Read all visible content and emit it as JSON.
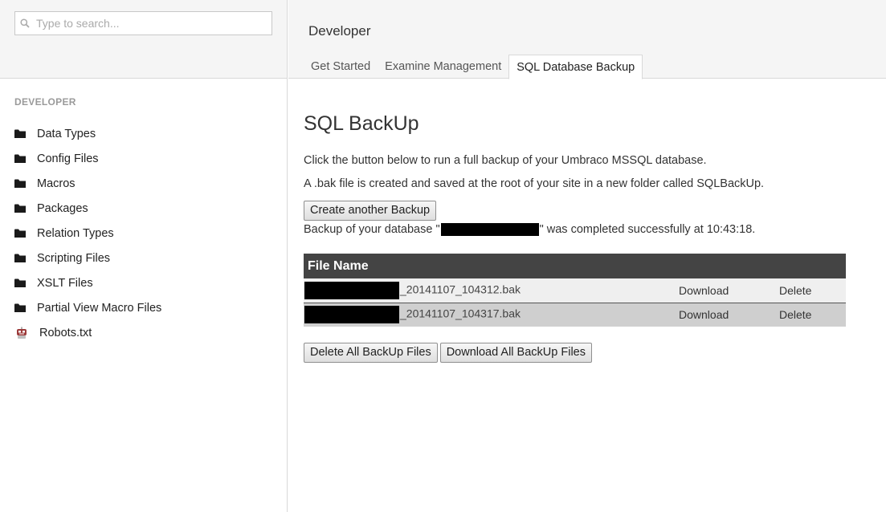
{
  "search": {
    "placeholder": "Type to search..."
  },
  "sidebar": {
    "heading": "DEVELOPER",
    "items": [
      {
        "label": "Data Types",
        "icon": "folder-icon"
      },
      {
        "label": "Config Files",
        "icon": "folder-icon"
      },
      {
        "label": "Macros",
        "icon": "folder-icon"
      },
      {
        "label": "Packages",
        "icon": "folder-icon"
      },
      {
        "label": "Relation Types",
        "icon": "folder-icon"
      },
      {
        "label": "Scripting Files",
        "icon": "folder-icon"
      },
      {
        "label": "XSLT Files",
        "icon": "folder-icon"
      },
      {
        "label": "Partial View Macro Files",
        "icon": "folder-icon"
      },
      {
        "label": "Robots.txt",
        "icon": "robot-icon"
      }
    ]
  },
  "header": {
    "section": "Developer",
    "tabs": [
      {
        "label": "Get Started",
        "active": false
      },
      {
        "label": "Examine Management",
        "active": false
      },
      {
        "label": "SQL Database Backup",
        "active": true
      }
    ]
  },
  "main": {
    "title": "SQL BackUp",
    "intro1": "Click the button below to run a full backup of your Umbraco MSSQL database.",
    "intro2": "A .bak file is created and saved at the root of your site in a new folder called SQLBackUp.",
    "backup_button": "Create another Backup",
    "status_prefix": "Backup of your database \"",
    "status_suffix": "\" was completed successfully at 10:43:18.",
    "table": {
      "header": "File Name",
      "rows": [
        {
          "file_suffix": "_20141107_104312.bak",
          "download": "Download",
          "delete": "Delete"
        },
        {
          "file_suffix": "_20141107_104317.bak",
          "download": "Download",
          "delete": "Delete"
        }
      ]
    },
    "delete_all_button": "Delete All BackUp Files",
    "download_all_button": "Download All BackUp Files"
  },
  "colors": {
    "table_header": "#444444",
    "row_a": "#efefef",
    "row_b": "#cfcfcf",
    "panel_bg": "#f5f5f5"
  }
}
